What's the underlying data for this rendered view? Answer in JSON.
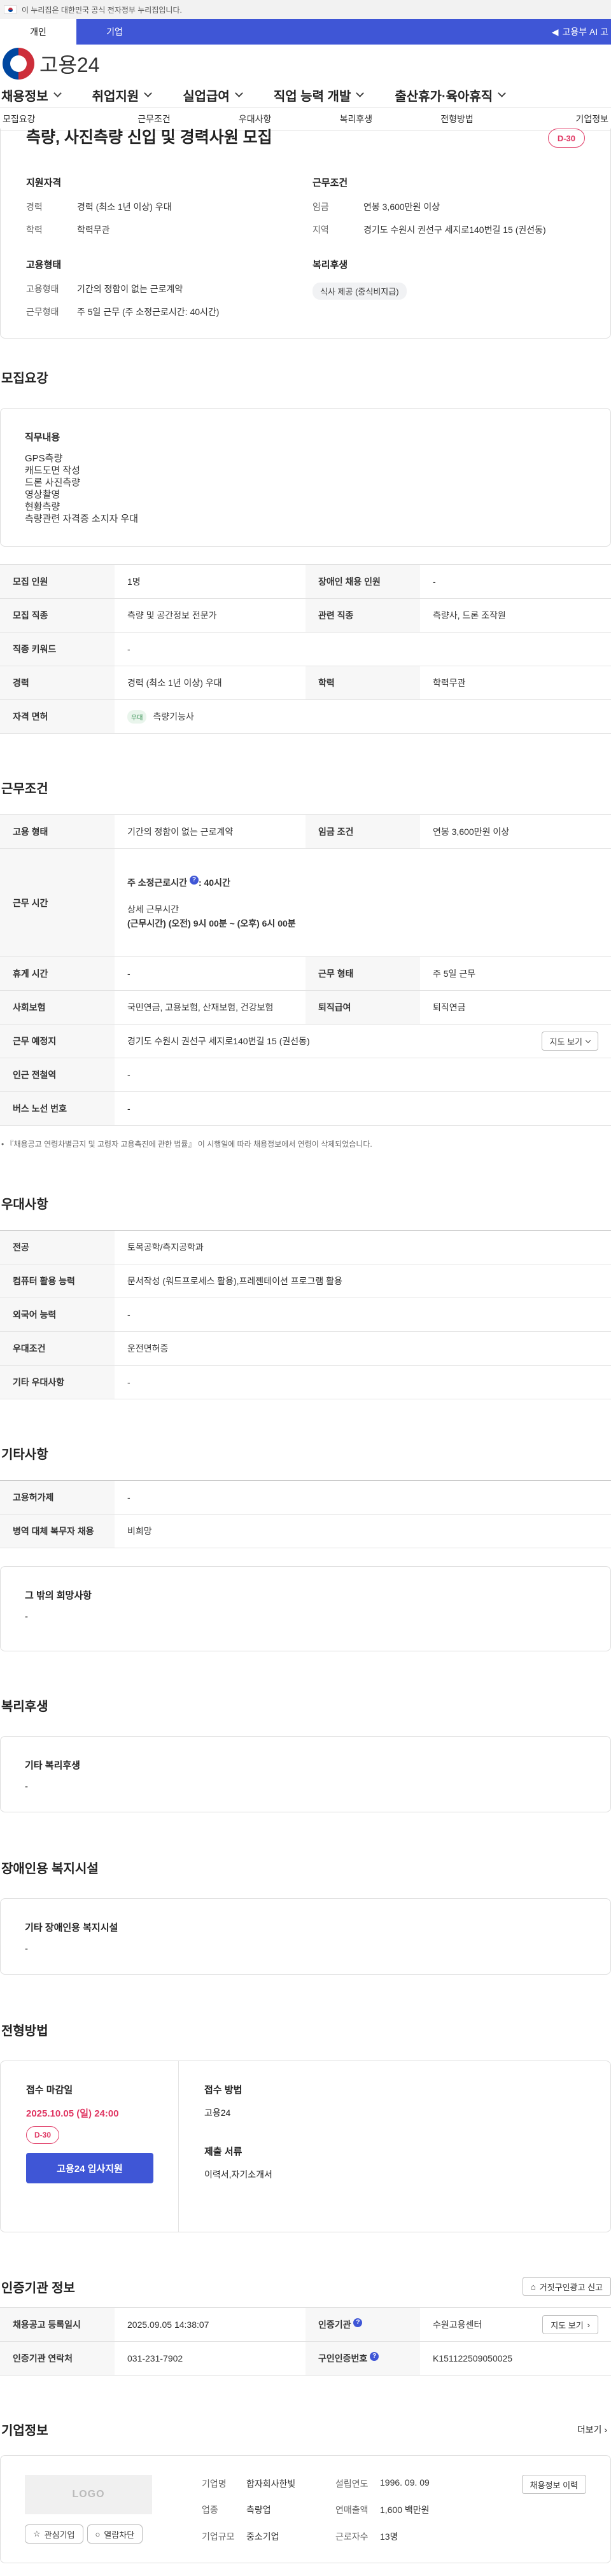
{
  "gov_banner": "이 누리집은 대한민국 공식 전자정부 누리집입니다.",
  "type_tabs": [
    "개인",
    "기업"
  ],
  "type_right": "고용부 AI 고",
  "logo_text": "고용24",
  "gnb": [
    "채용정보",
    "취업지원",
    "실업급여",
    "직업 능력 개발",
    "출산휴가·육아휴직"
  ],
  "anchors": [
    "모집요강",
    "근무조건",
    "우대사항",
    "복리후생",
    "전형방법",
    "기업정보"
  ],
  "summary": {
    "title": "측량, 사진측량 신입 및 경력사원 모집",
    "dday": "D-30",
    "qual_title": "지원자격",
    "qual": [
      {
        "k": "경력",
        "v": "경력 (최소 1년 이상) 우대"
      },
      {
        "k": "학력",
        "v": "학력무관"
      }
    ],
    "cond_title": "근무조건",
    "cond": [
      {
        "k": "임금",
        "v": "연봉 3,600만원 이상"
      },
      {
        "k": "지역",
        "v": "경기도 수원시 권선구 세지로140번길 15 (권선동)"
      }
    ],
    "emp_title": "고용형태",
    "emp": [
      {
        "k": "고용형태",
        "v": "기간의 정함이 없는 근로계약"
      },
      {
        "k": "근무형태",
        "v": "주 5일 근무 (주 소정근로시간: 40시간)"
      }
    ],
    "welfare_title": "복리후생",
    "welfare_chip": "식사 제공 (중식비지급)"
  },
  "recruit": {
    "title": "모집요강",
    "duty_title": "직무내용",
    "duty_lines": [
      "GPS측량",
      "캐드도면 작성",
      "드론 사진측량",
      "영상촬영",
      "현황측량",
      "측량관련 자격증 소지자 우대"
    ],
    "rows": {
      "headcount_k": "모집 인원",
      "headcount_v": "1명",
      "disabled_k": "장애인 채용 인원",
      "disabled_v": "-",
      "job_k": "모집 직종",
      "job_v": "측량 및 공간정보 전문가",
      "related_k": "관련 직종",
      "related_v": "측량사, 드론 조작원",
      "keyword_k": "직종 키워드",
      "keyword_v": "-",
      "career_k": "경력",
      "career_v": "경력 (최소 1년 이상) 우대",
      "edu_k": "학력",
      "edu_v": "학력무관",
      "license_k": "자격 면허",
      "license_badge": "우대",
      "license_v": "측량기능사"
    }
  },
  "work": {
    "title": "근무조건",
    "emp_k": "고용 형태",
    "emp_v": "기간의 정함이 없는 근로계약",
    "wage_k": "임금 조건",
    "wage_v": "연봉 3,600만원 이상",
    "hours_k": "근무 시간",
    "hours_line1": "주 소정근로시간",
    "hours_line1_val": ": 40시간",
    "hours_detail_title": "상세 근무시간",
    "hours_detail": "(근무시간) (오전) 9시 00분 ~ (오후) 6시 00분",
    "break_k": "휴게 시간",
    "break_v": "-",
    "shift_k": "근무 형태",
    "shift_v": "주 5일 근무",
    "insurance_k": "사회보험",
    "insurance_v": "국민연금, 고용보험, 산재보험, 건강보험",
    "severance_k": "퇴직급여",
    "severance_v": "퇴직연금",
    "place_k": "근무 예정지",
    "place_v": "경기도 수원시 권선구 세지로140번길 15 (권선동)",
    "map_btn": "지도 보기",
    "subway_k": "인근 전철역",
    "subway_v": "-",
    "bus_k": "버스 노선 번호",
    "bus_v": "-",
    "note": "『채용공고 연령차별금지 및 고령자 고용촉진에 관한 법률』 이 시행일에 따라 채용정보에서 연령이 삭제되었습니다."
  },
  "pref": {
    "title": "우대사항",
    "major_k": "전공",
    "major_v": "토목공학/측지공학과",
    "pc_k": "컴퓨터 활용 능력",
    "pc_v": "문서작성 (워드프로세스 활용),프레젠테이션 프로그램 활용",
    "lang_k": "외국어 능력",
    "lang_v": "-",
    "cond_k": "우대조건",
    "cond_v": "운전면허증",
    "etc_k": "기타 우대사항",
    "etc_v": "-"
  },
  "etc": {
    "title": "기타사항",
    "hire_k": "고용허가제",
    "hire_v": "-",
    "army_k": "병역 대체 복무자 채용",
    "army_v": "비희망",
    "wish_title": "그 밖의 희망사항",
    "wish_v": "-"
  },
  "welfare": {
    "title": "복리후생",
    "box_title": "기타 복리후생",
    "box_v": "-"
  },
  "disabled": {
    "title": "장애인용 복지시설",
    "box_title": "기타 장애인용 복지시설",
    "box_v": "-"
  },
  "apply": {
    "title": "전형방법",
    "deadline_title": "접수 마감일",
    "deadline": "2025.10.05 (일) 24:00",
    "dday": "D-30",
    "apply_btn": "고용24 입사지원",
    "method_title": "접수 방법",
    "method_v": "고용24",
    "docs_title": "제출 서류",
    "docs_v": "이력서,자기소개서"
  },
  "cert": {
    "title": "인증기관 정보",
    "report_btn": "거짓구인광고 신고",
    "reg_k": "채용공고 등록일시",
    "reg_v": "2025.09.05 14:38:07",
    "org_k": "인증기관",
    "org_v": "수원고용센터",
    "map_btn": "지도 보기",
    "contact_k": "인증기관 연락처",
    "contact_v": "031-231-7902",
    "num_k": "구인인증번호",
    "num_v": "K151122509050025"
  },
  "company": {
    "title": "기업정보",
    "more": "더보기",
    "logo_placeholder": "LOGO",
    "fav_btn": "관심기업",
    "block_btn": "열람차단",
    "name_k": "기업명",
    "name_v": "합자회사한빛",
    "founded_k": "설립연도",
    "founded_v": "1996. 09. 09",
    "industry_k": "업종",
    "industry_v": "측량업",
    "sales_k": "연매출액",
    "sales_v": "1,600 백만원",
    "size_k": "기업규모",
    "size_v": "중소기업",
    "staff_k": "근로자수",
    "staff_v": "13명",
    "history_btn": "채용정보 이력"
  },
  "colors": {
    "brand": "#3f56d6",
    "dday": "#e03864"
  }
}
